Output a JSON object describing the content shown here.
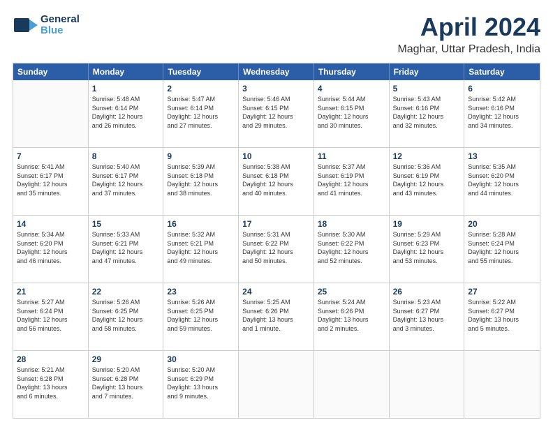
{
  "logo": {
    "line1": "General",
    "line2": "Blue"
  },
  "title": "April 2024",
  "subtitle": "Maghar, Uttar Pradesh, India",
  "days": [
    "Sunday",
    "Monday",
    "Tuesday",
    "Wednesday",
    "Thursday",
    "Friday",
    "Saturday"
  ],
  "weeks": [
    [
      {
        "day": "",
        "info": ""
      },
      {
        "day": "1",
        "info": "Sunrise: 5:48 AM\nSunset: 6:14 PM\nDaylight: 12 hours\nand 26 minutes."
      },
      {
        "day": "2",
        "info": "Sunrise: 5:47 AM\nSunset: 6:14 PM\nDaylight: 12 hours\nand 27 minutes."
      },
      {
        "day": "3",
        "info": "Sunrise: 5:46 AM\nSunset: 6:15 PM\nDaylight: 12 hours\nand 29 minutes."
      },
      {
        "day": "4",
        "info": "Sunrise: 5:44 AM\nSunset: 6:15 PM\nDaylight: 12 hours\nand 30 minutes."
      },
      {
        "day": "5",
        "info": "Sunrise: 5:43 AM\nSunset: 6:16 PM\nDaylight: 12 hours\nand 32 minutes."
      },
      {
        "day": "6",
        "info": "Sunrise: 5:42 AM\nSunset: 6:16 PM\nDaylight: 12 hours\nand 34 minutes."
      }
    ],
    [
      {
        "day": "7",
        "info": "Sunrise: 5:41 AM\nSunset: 6:17 PM\nDaylight: 12 hours\nand 35 minutes."
      },
      {
        "day": "8",
        "info": "Sunrise: 5:40 AM\nSunset: 6:17 PM\nDaylight: 12 hours\nand 37 minutes."
      },
      {
        "day": "9",
        "info": "Sunrise: 5:39 AM\nSunset: 6:18 PM\nDaylight: 12 hours\nand 38 minutes."
      },
      {
        "day": "10",
        "info": "Sunrise: 5:38 AM\nSunset: 6:18 PM\nDaylight: 12 hours\nand 40 minutes."
      },
      {
        "day": "11",
        "info": "Sunrise: 5:37 AM\nSunset: 6:19 PM\nDaylight: 12 hours\nand 41 minutes."
      },
      {
        "day": "12",
        "info": "Sunrise: 5:36 AM\nSunset: 6:19 PM\nDaylight: 12 hours\nand 43 minutes."
      },
      {
        "day": "13",
        "info": "Sunrise: 5:35 AM\nSunset: 6:20 PM\nDaylight: 12 hours\nand 44 minutes."
      }
    ],
    [
      {
        "day": "14",
        "info": "Sunrise: 5:34 AM\nSunset: 6:20 PM\nDaylight: 12 hours\nand 46 minutes."
      },
      {
        "day": "15",
        "info": "Sunrise: 5:33 AM\nSunset: 6:21 PM\nDaylight: 12 hours\nand 47 minutes."
      },
      {
        "day": "16",
        "info": "Sunrise: 5:32 AM\nSunset: 6:21 PM\nDaylight: 12 hours\nand 49 minutes."
      },
      {
        "day": "17",
        "info": "Sunrise: 5:31 AM\nSunset: 6:22 PM\nDaylight: 12 hours\nand 50 minutes."
      },
      {
        "day": "18",
        "info": "Sunrise: 5:30 AM\nSunset: 6:22 PM\nDaylight: 12 hours\nand 52 minutes."
      },
      {
        "day": "19",
        "info": "Sunrise: 5:29 AM\nSunset: 6:23 PM\nDaylight: 12 hours\nand 53 minutes."
      },
      {
        "day": "20",
        "info": "Sunrise: 5:28 AM\nSunset: 6:24 PM\nDaylight: 12 hours\nand 55 minutes."
      }
    ],
    [
      {
        "day": "21",
        "info": "Sunrise: 5:27 AM\nSunset: 6:24 PM\nDaylight: 12 hours\nand 56 minutes."
      },
      {
        "day": "22",
        "info": "Sunrise: 5:26 AM\nSunset: 6:25 PM\nDaylight: 12 hours\nand 58 minutes."
      },
      {
        "day": "23",
        "info": "Sunrise: 5:26 AM\nSunset: 6:25 PM\nDaylight: 12 hours\nand 59 minutes."
      },
      {
        "day": "24",
        "info": "Sunrise: 5:25 AM\nSunset: 6:26 PM\nDaylight: 13 hours\nand 1 minute."
      },
      {
        "day": "25",
        "info": "Sunrise: 5:24 AM\nSunset: 6:26 PM\nDaylight: 13 hours\nand 2 minutes."
      },
      {
        "day": "26",
        "info": "Sunrise: 5:23 AM\nSunset: 6:27 PM\nDaylight: 13 hours\nand 3 minutes."
      },
      {
        "day": "27",
        "info": "Sunrise: 5:22 AM\nSunset: 6:27 PM\nDaylight: 13 hours\nand 5 minutes."
      }
    ],
    [
      {
        "day": "28",
        "info": "Sunrise: 5:21 AM\nSunset: 6:28 PM\nDaylight: 13 hours\nand 6 minutes."
      },
      {
        "day": "29",
        "info": "Sunrise: 5:20 AM\nSunset: 6:28 PM\nDaylight: 13 hours\nand 7 minutes."
      },
      {
        "day": "30",
        "info": "Sunrise: 5:20 AM\nSunset: 6:29 PM\nDaylight: 13 hours\nand 9 minutes."
      },
      {
        "day": "",
        "info": ""
      },
      {
        "day": "",
        "info": ""
      },
      {
        "day": "",
        "info": ""
      },
      {
        "day": "",
        "info": ""
      }
    ]
  ]
}
